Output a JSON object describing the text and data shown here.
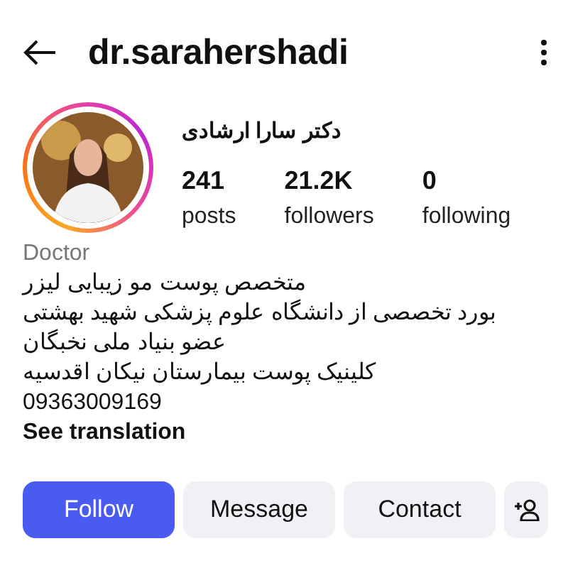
{
  "header": {
    "username": "dr.sarahershadi"
  },
  "profile": {
    "display_name": "دکتر سارا ارشادی",
    "stats": [
      {
        "value": "241",
        "label": "posts"
      },
      {
        "value": "21.2K",
        "label": "followers"
      },
      {
        "value": "0",
        "label": "following"
      }
    ]
  },
  "bio": {
    "category": "Doctor",
    "lines": [
      "متخصص پوست مو زیبایی لیزر",
      "بورد تخصصی از دانشگاه علوم پزشکی شهید بهشتی",
      "عضو بنیاد ملی نخبگان",
      "کلینیک پوست بیمارستان نیکان اقدسیه"
    ],
    "phone": "09363009169",
    "translation_link": "See translation"
  },
  "actions": [
    {
      "label": "Follow",
      "kind": "primary"
    },
    {
      "label": "Message",
      "kind": "secondary"
    },
    {
      "label": "Contact",
      "kind": "secondary"
    }
  ]
}
